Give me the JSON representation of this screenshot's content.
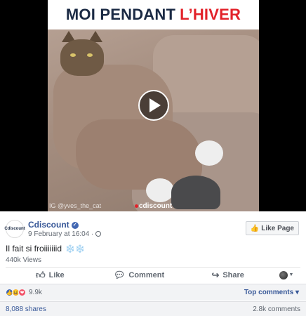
{
  "video": {
    "title_main": "MOI PENDANT",
    "title_accent": "L’HIVER",
    "watermark": "IG @yves_the_cat",
    "brand": "cdiscount"
  },
  "post": {
    "page_name": "Cdiscount",
    "avatar_text": "Cdiscount",
    "date": "9 February at 16:04 ·",
    "like_page_label": "Like Page",
    "caption": "Il fait si froiiiiiiid",
    "caption_emoji": "❄️❄️",
    "views": "440k Views"
  },
  "actions": {
    "like": "Like",
    "comment": "Comment",
    "share": "Share"
  },
  "reactions": {
    "count": "9.9k",
    "top_comments": "Top comments ▾"
  },
  "footer": {
    "shares": "8,088 shares",
    "comments": "2.8k comments"
  },
  "colors": {
    "link": "#385898",
    "accent": "#e2222a",
    "like_blue": "#4267b2"
  }
}
